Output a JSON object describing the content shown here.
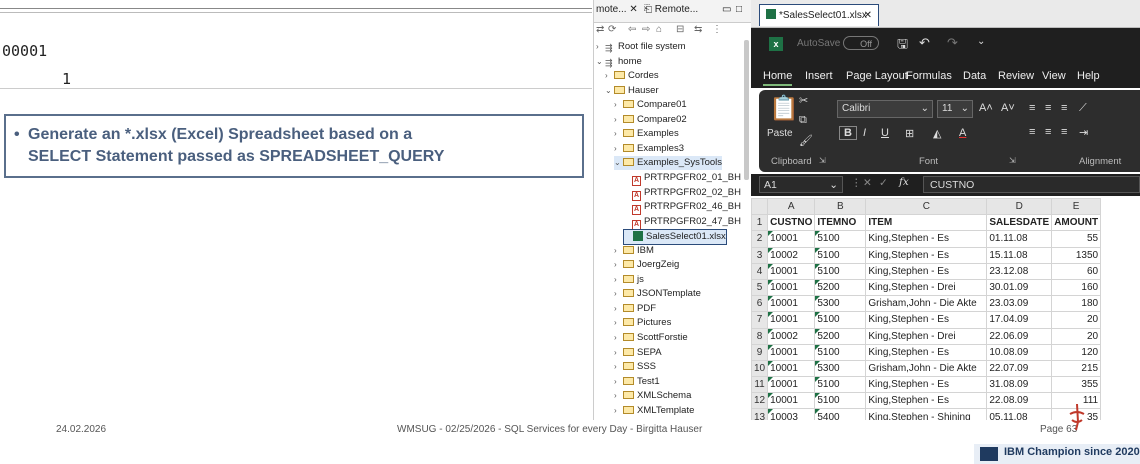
{
  "slide": {
    "line_seq": "00001",
    "line_value": "1",
    "bullet_line1": "Generate an *.xlsx (Excel) Spreadsheet based on a",
    "bullet_line2": "SELECT Statement passed as SPREADSHEET_QUERY",
    "footer_date": "24.02.2026",
    "footer_center": "WMSUG - 02/25/2026 - SQL Services for every Day - Birgitta Hauser",
    "footer_page": "Page 63",
    "champion_text": "IBM Champion since 2020"
  },
  "explorer": {
    "tab1": "mote...",
    "tab2": "Remote...",
    "tree": [
      {
        "label": "Root file system",
        "indent": 0,
        "twisty": ">",
        "icon": "server-icon"
      },
      {
        "label": "home",
        "indent": 0,
        "twisty": "v",
        "icon": "server-icon"
      },
      {
        "label": "Cordes",
        "indent": 1,
        "twisty": ">",
        "icon": "folder-icon"
      },
      {
        "label": "Hauser",
        "indent": 1,
        "twisty": "v",
        "icon": "folder-icon"
      },
      {
        "label": "Compare01",
        "indent": 2,
        "twisty": ">",
        "icon": "folder-icon"
      },
      {
        "label": "Compare02",
        "indent": 2,
        "twisty": ">",
        "icon": "folder-icon"
      },
      {
        "label": "Examples",
        "indent": 2,
        "twisty": ">",
        "icon": "folder-icon"
      },
      {
        "label": "Examples3",
        "indent": 2,
        "twisty": ">",
        "icon": "folder-icon"
      },
      {
        "label": "Examples_SysTools",
        "indent": 2,
        "twisty": "v",
        "icon": "folder-icon",
        "highlight": true
      },
      {
        "label": "PRTRPGFR02_01_BH",
        "indent": 3,
        "twisty": "",
        "icon": "pdf-icon"
      },
      {
        "label": "PRTRPGFR02_02_BH",
        "indent": 3,
        "twisty": "",
        "icon": "pdf-icon"
      },
      {
        "label": "PRTRPGFR02_46_BH",
        "indent": 3,
        "twisty": "",
        "icon": "pdf-icon"
      },
      {
        "label": "PRTRPGFR02_47_BH",
        "indent": 3,
        "twisty": "",
        "icon": "pdf-icon"
      },
      {
        "label": "SalesSelect01.xlsx",
        "indent": 3,
        "twisty": "",
        "icon": "excel-file-icon",
        "selected": true
      },
      {
        "label": "IBM",
        "indent": 2,
        "twisty": ">",
        "icon": "folder-icon"
      },
      {
        "label": "JoergZeig",
        "indent": 2,
        "twisty": ">",
        "icon": "folder-icon"
      },
      {
        "label": "js",
        "indent": 2,
        "twisty": ">",
        "icon": "folder-icon"
      },
      {
        "label": "JSONTemplate",
        "indent": 2,
        "twisty": ">",
        "icon": "folder-icon"
      },
      {
        "label": "PDF",
        "indent": 2,
        "twisty": ">",
        "icon": "folder-icon"
      },
      {
        "label": "Pictures",
        "indent": 2,
        "twisty": ">",
        "icon": "folder-icon"
      },
      {
        "label": "ScottForstie",
        "indent": 2,
        "twisty": ">",
        "icon": "folder-icon"
      },
      {
        "label": "SEPA",
        "indent": 2,
        "twisty": ">",
        "icon": "folder-icon"
      },
      {
        "label": "SSS",
        "indent": 2,
        "twisty": ">",
        "icon": "folder-icon"
      },
      {
        "label": "Test1",
        "indent": 2,
        "twisty": ">",
        "icon": "folder-icon"
      },
      {
        "label": "XMLSchema",
        "indent": 2,
        "twisty": ">",
        "icon": "folder-icon"
      },
      {
        "label": "XMLTemplate",
        "indent": 2,
        "twisty": ">",
        "icon": "folder-icon"
      }
    ]
  },
  "excel": {
    "file_tab": "*SalesSelect01.xlsx",
    "autosave_label": "AutoSave",
    "autosave_state": "Off",
    "menu": [
      "Home",
      "Insert",
      "Page Layout",
      "Formulas",
      "Data",
      "Review",
      "View",
      "Help"
    ],
    "paste_label": "Paste",
    "font_name": "Calibri",
    "font_size": "11",
    "group_clipboard": "Clipboard",
    "group_font": "Font",
    "group_alignment": "Alignment",
    "name_box": "A1",
    "formula_value": "CUSTNO",
    "columns": [
      "A",
      "B",
      "C",
      "D",
      "E"
    ],
    "rows": [
      [
        "CUSTNO",
        "ITEMNO",
        "ITEM",
        "SALESDATE",
        "AMOUNT"
      ],
      [
        "10001",
        "5100",
        "King,Stephen - Es",
        "01.11.08",
        "55"
      ],
      [
        "10002",
        "5100",
        "King,Stephen - Es",
        "15.11.08",
        "1350"
      ],
      [
        "10001",
        "5100",
        "King,Stephen - Es",
        "23.12.08",
        "60"
      ],
      [
        "10001",
        "5200",
        "King,Stephen - Drei",
        "30.01.09",
        "160"
      ],
      [
        "10001",
        "5300",
        "Grisham,John - Die Akte",
        "23.03.09",
        "180"
      ],
      [
        "10001",
        "5100",
        "King,Stephen - Es",
        "17.04.09",
        "20"
      ],
      [
        "10002",
        "5200",
        "King,Stephen - Drei",
        "22.06.09",
        "20"
      ],
      [
        "10001",
        "5100",
        "King,Stephen - Es",
        "10.08.09",
        "120"
      ],
      [
        "10001",
        "5300",
        "Grisham,John - Die Akte",
        "22.07.09",
        "215"
      ],
      [
        "10001",
        "5100",
        "King,Stephen - Es",
        "31.08.09",
        "355"
      ],
      [
        "10001",
        "5100",
        "King,Stephen - Es",
        "22.08.09",
        "111"
      ],
      [
        "10003",
        "5400",
        "King,Stephen - Shining",
        "05.11.08",
        "35"
      ]
    ]
  }
}
